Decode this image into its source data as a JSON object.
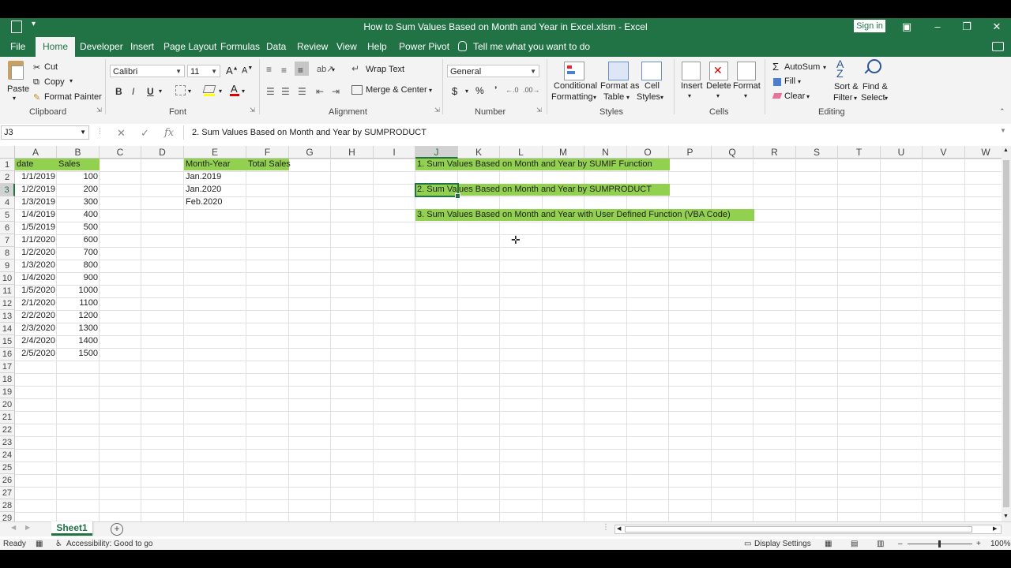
{
  "window": {
    "title": "How to Sum Values Based on Month and Year in Excel.xlsm  -  Excel",
    "sign_in": "Sign in"
  },
  "tabs": [
    "File",
    "Home",
    "Developer",
    "Insert",
    "Page Layout",
    "Formulas",
    "Data",
    "Review",
    "View",
    "Help",
    "Power Pivot"
  ],
  "tell_me": "Tell me what you want to do",
  "ribbon": {
    "clipboard": {
      "paste": "Paste",
      "cut": "Cut",
      "copy": "Copy",
      "format_painter": "Format Painter",
      "label": "Clipboard"
    },
    "font": {
      "name": "Calibri",
      "size": "11",
      "bold": "B",
      "italic": "I",
      "underline": "U",
      "label": "Font"
    },
    "alignment": {
      "wrap_text": "Wrap Text",
      "merge_center": "Merge & Center",
      "label": "Alignment"
    },
    "number": {
      "format": "General",
      "currency": "$",
      "percent": "%",
      "comma": "’",
      "label": "Number"
    },
    "styles": {
      "conditional_1": "Conditional",
      "conditional_2": "Formatting",
      "format_table_1": "Format as",
      "format_table_2": "Table",
      "cell_styles_1": "Cell",
      "cell_styles_2": "Styles",
      "label": "Styles"
    },
    "cells": {
      "insert": "Insert",
      "delete": "Delete",
      "format": "Format",
      "label": "Cells"
    },
    "editing": {
      "autosum": "AutoSum",
      "fill": "Fill",
      "clear": "Clear",
      "sort_1": "Sort &",
      "sort_2": "Filter",
      "find_1": "Find &",
      "find_2": "Select",
      "label": "Editing"
    }
  },
  "formula_bar": {
    "name_box": "J3",
    "fx": "fx",
    "content": "2. Sum Values Based on Month and Year by SUMPRODUCT"
  },
  "columns": [
    "A",
    "B",
    "C",
    "D",
    "E",
    "F",
    "G",
    "H",
    "I",
    "J",
    "K",
    "L",
    "M",
    "N",
    "O",
    "P",
    "Q",
    "R",
    "S",
    "T",
    "U",
    "V",
    "W"
  ],
  "rows": [
    "1",
    "2",
    "3",
    "4",
    "5",
    "6",
    "7",
    "8",
    "9",
    "10",
    "11",
    "12",
    "13",
    "14",
    "15",
    "16",
    "17",
    "18",
    "19",
    "20",
    "21",
    "22",
    "23",
    "24",
    "25",
    "26",
    "27",
    "28",
    "29"
  ],
  "sheet": {
    "header_date": "date",
    "header_sales": "Sales",
    "data": [
      [
        "1/1/2019",
        "100"
      ],
      [
        "1/2/2019",
        "200"
      ],
      [
        "1/3/2019",
        "300"
      ],
      [
        "1/4/2019",
        "400"
      ],
      [
        "1/5/2019",
        "500"
      ],
      [
        "1/1/2020",
        "600"
      ],
      [
        "1/2/2020",
        "700"
      ],
      [
        "1/3/2020",
        "800"
      ],
      [
        "1/4/2020",
        "900"
      ],
      [
        "1/5/2020",
        "1000"
      ],
      [
        "2/1/2020",
        "1100"
      ],
      [
        "2/2/2020",
        "1200"
      ],
      [
        "2/3/2020",
        "1300"
      ],
      [
        "2/4/2020",
        "1400"
      ],
      [
        "2/5/2020",
        "1500"
      ]
    ],
    "header_month_year": "Month-Year",
    "header_total_sales": "Total Sales",
    "month_years": [
      "Jan.2019",
      "Jan.2020",
      "Feb.2020"
    ],
    "notes": [
      "1. Sum Values Based on Month and Year by SUMIF Function",
      "2. Sum Values Based on Month and Year by SUMPRODUCT",
      "3. Sum Values Based on Month and Year with User Defined Function (VBA Code)"
    ]
  },
  "sheet_tab": "Sheet1",
  "status": {
    "ready": "Ready",
    "accessibility": "Accessibility: Good to go",
    "display_settings": "Display Settings",
    "zoom": "100%"
  },
  "colors": {
    "excel_green": "#217346",
    "cell_highlight": "#92d050"
  }
}
